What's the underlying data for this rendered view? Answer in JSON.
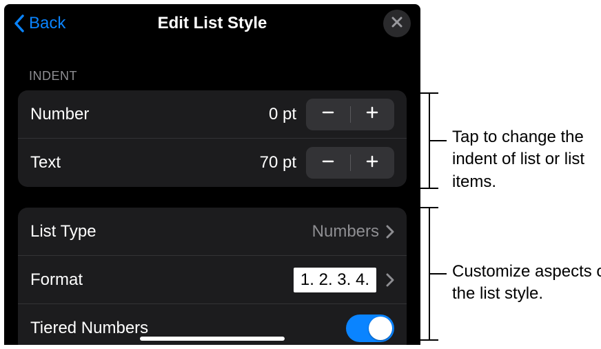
{
  "nav": {
    "back_label": "Back",
    "title": "Edit List Style"
  },
  "section": {
    "indent_header": "INDENT"
  },
  "indent": {
    "number_label": "Number",
    "number_value": "0 pt",
    "text_label": "Text",
    "text_value": "70 pt"
  },
  "list": {
    "list_type_label": "List Type",
    "list_type_value": "Numbers",
    "format_label": "Format",
    "format_preview": "1. 2. 3. 4.",
    "tiered_label": "Tiered Numbers",
    "tiered_on": true
  },
  "callouts": {
    "indent": "Tap to change the indent of list or list items.",
    "style": "Customize aspects of the list style."
  }
}
